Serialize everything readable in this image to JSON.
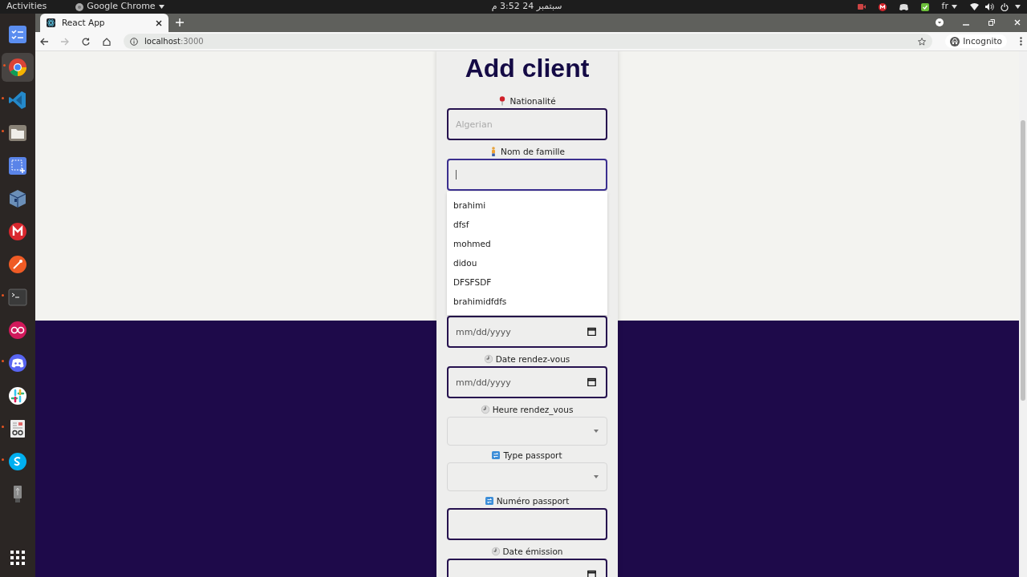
{
  "topbar": {
    "activities": "Activities",
    "app_menu": "Google Chrome",
    "clock": "سبتمبر 24 3:52 م",
    "input_language": "fr"
  },
  "dock": [
    {
      "kind": "tasks",
      "running": false,
      "selected": false
    },
    {
      "kind": "chrome",
      "running": true,
      "selected": true
    },
    {
      "kind": "vscode",
      "running": true,
      "selected": false
    },
    {
      "kind": "files",
      "running": true,
      "selected": false
    },
    {
      "kind": "screenshot",
      "running": false,
      "selected": false
    },
    {
      "kind": "virtualbox",
      "running": false,
      "selected": false
    },
    {
      "kind": "mega",
      "running": false,
      "selected": false
    },
    {
      "kind": "postman",
      "running": false,
      "selected": false
    },
    {
      "kind": "terminal",
      "running": true,
      "selected": false
    },
    {
      "kind": "rings",
      "running": false,
      "selected": false
    },
    {
      "kind": "discord",
      "running": true,
      "selected": false
    },
    {
      "kind": "slack",
      "running": false,
      "selected": false
    },
    {
      "kind": "docviewer",
      "running": true,
      "selected": false
    },
    {
      "kind": "skype",
      "running": true,
      "selected": false
    },
    {
      "kind": "usb",
      "running": false,
      "selected": false
    },
    {
      "kind": "grid",
      "running": false,
      "selected": false
    }
  ],
  "browser": {
    "tab_title": "React App",
    "url_host": "localhost",
    "url_port": ":3000",
    "profile": "Incognito",
    "forward_disabled": true
  },
  "form": {
    "title": "Add client",
    "fields": [
      {
        "kind": "text",
        "label": "Nationalité",
        "placeholder": "Algerian",
        "focused": false
      },
      {
        "kind": "text",
        "label": "Nom de famille",
        "focused": true,
        "suggestions": [
          "brahimi",
          "dfsf",
          "mohmed",
          "didou",
          "DFSFSDF",
          "brahimidfdfs"
        ]
      },
      {
        "kind": "date",
        "placeholder": "mm/dd/yyyy",
        "focused": false
      },
      {
        "kind": "date",
        "label": "Date rendez-vous",
        "placeholder": "mm/dd/yyyy",
        "focused": false
      },
      {
        "kind": "select",
        "label": "Heure rendez_vous"
      },
      {
        "kind": "select",
        "label": "Type passport"
      },
      {
        "kind": "text",
        "label": "Numéro passport",
        "focused": false
      },
      {
        "kind": "date",
        "label": "Date émission",
        "focused": false
      }
    ]
  }
}
